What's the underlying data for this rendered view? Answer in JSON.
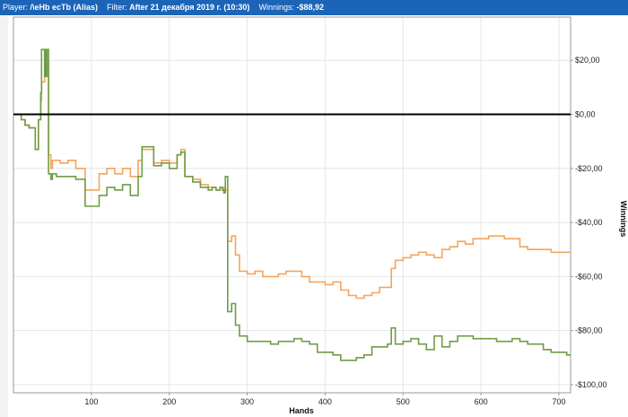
{
  "header": {
    "player_label": "Player:",
    "player_value": "/\\eHb ecTb (Alias)",
    "filter_label": "Filter:",
    "filter_value": "After 21 декабря 2019 г. (10:30)",
    "winnings_label": "Winnings:",
    "winnings_value": "-$88,92",
    "bg_color": "#1c64b7"
  },
  "chart_data": {
    "type": "line",
    "title": "",
    "xlabel": "Hands",
    "ylabel": "Winnings",
    "xlim": [
      0,
      715
    ],
    "ylim": [
      -103,
      36
    ],
    "x_ticks": [
      100,
      200,
      300,
      400,
      500,
      600,
      700
    ],
    "y_ticks": [
      20,
      0,
      -20,
      -40,
      -60,
      -80,
      -100
    ],
    "y_tick_labels": [
      "$20,00",
      "$0,00",
      "-$20,00",
      "-$40,00",
      "-$60,00",
      "-$80,00",
      "-$100,00"
    ],
    "y_axis_side": "right",
    "grid": true,
    "zero_line": true,
    "series": [
      {
        "color": "#f4a55e",
        "x": [
          0,
          5,
          10,
          15,
          20,
          25,
          28,
          30,
          32,
          34,
          35,
          36,
          37,
          40,
          41,
          42,
          43,
          45,
          48,
          50,
          55,
          60,
          70,
          80,
          90,
          92,
          100,
          110,
          120,
          130,
          140,
          150,
          160,
          165,
          170,
          180,
          190,
          200,
          210,
          215,
          220,
          230,
          240,
          250,
          255,
          260,
          265,
          268,
          270,
          272,
          275,
          280,
          285,
          290,
          300,
          310,
          320,
          330,
          340,
          350,
          360,
          370,
          380,
          390,
          400,
          410,
          420,
          430,
          440,
          450,
          460,
          470,
          480,
          485,
          490,
          500,
          510,
          520,
          530,
          540,
          550,
          560,
          570,
          580,
          590,
          600,
          610,
          620,
          630,
          640,
          650,
          660,
          670,
          680,
          690,
          700,
          710,
          715
        ],
        "y": [
          0,
          0,
          -2,
          -4,
          -5,
          -5,
          -13,
          -13,
          -2,
          -2,
          5,
          12,
          12,
          14,
          20,
          18,
          20,
          -15,
          -20,
          -17,
          -17,
          -18,
          -17,
          -20,
          -20,
          -28,
          -28,
          -22,
          -20,
          -22,
          -20,
          -23,
          -17,
          -13,
          -13,
          -18,
          -17,
          -18,
          -15,
          -13,
          -23,
          -24,
          -26,
          -27,
          -27,
          -28,
          -27,
          -28,
          -27,
          -28,
          -47,
          -45,
          -52,
          -58,
          -59,
          -58,
          -60,
          -60,
          -59,
          -58,
          -58,
          -60,
          -62,
          -62,
          -63,
          -62,
          -65,
          -67,
          -68,
          -67,
          -66,
          -64,
          -64,
          -57,
          -54,
          -53,
          -52,
          -51,
          -52,
          -53,
          -50,
          -49,
          -47,
          -48,
          -46,
          -46,
          -45,
          -45,
          -46,
          -46,
          -49,
          -50,
          -50,
          -50,
          -51,
          -51,
          -51,
          -51
        ]
      },
      {
        "color": "#6f9d47",
        "x": [
          0,
          5,
          10,
          15,
          20,
          25,
          28,
          30,
          32,
          34,
          35,
          36,
          37,
          40,
          41,
          42,
          43,
          45,
          48,
          50,
          55,
          60,
          70,
          80,
          90,
          92,
          100,
          110,
          120,
          130,
          140,
          150,
          160,
          165,
          170,
          180,
          190,
          200,
          210,
          215,
          220,
          230,
          240,
          250,
          255,
          260,
          265,
          268,
          270,
          272,
          275,
          280,
          285,
          290,
          300,
          310,
          320,
          330,
          340,
          350,
          360,
          370,
          380,
          390,
          400,
          410,
          420,
          430,
          440,
          450,
          460,
          470,
          480,
          485,
          490,
          500,
          510,
          520,
          530,
          540,
          550,
          560,
          570,
          580,
          590,
          600,
          610,
          620,
          630,
          640,
          650,
          660,
          670,
          680,
          690,
          700,
          710,
          715
        ],
        "y": [
          0,
          0,
          -2,
          -4,
          -5,
          -5,
          -13,
          -13,
          -2,
          -2,
          8,
          24,
          24,
          14,
          24,
          14,
          24,
          -22,
          -24,
          -22,
          -23,
          -23,
          -23,
          -24,
          -24,
          -34,
          -34,
          -30,
          -27,
          -28,
          -26,
          -30,
          -23,
          -12,
          -12,
          -19,
          -18,
          -20,
          -15,
          -14,
          -23,
          -25,
          -27,
          -28,
          -27,
          -28,
          -27,
          -28,
          -29,
          -23,
          -73,
          -70,
          -78,
          -82,
          -84,
          -84,
          -84,
          -85,
          -84,
          -84,
          -83,
          -84,
          -85,
          -88,
          -88,
          -89,
          -91,
          -91,
          -90,
          -89,
          -86,
          -86,
          -85,
          -79,
          -85,
          -84,
          -83,
          -85,
          -87,
          -82,
          -86,
          -84,
          -82,
          -82,
          -83,
          -83,
          -83,
          -84,
          -84,
          -83,
          -84,
          -85,
          -85,
          -87,
          -88,
          -88,
          -89,
          -89
        ]
      }
    ]
  }
}
